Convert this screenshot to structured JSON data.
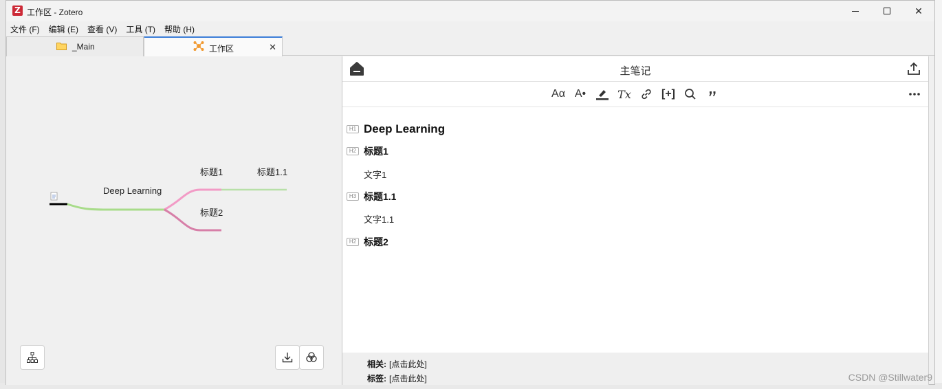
{
  "window": {
    "title": "工作区 - Zotero",
    "logo_letter": "Z",
    "controls": {
      "minimize": "minimize-icon",
      "maximize": "maximize-icon",
      "close": "✕"
    }
  },
  "menubar": {
    "items": [
      "文件 (F)",
      "编辑 (E)",
      "查看 (V)",
      "工具 (T)",
      "帮助 (H)"
    ]
  },
  "tabs": [
    {
      "label": "_Main",
      "icon": "folder-icon",
      "active": false
    },
    {
      "label": "工作区",
      "icon": "mindmap-icon",
      "active": true,
      "close": "✕"
    }
  ],
  "mindmap": {
    "root": "Deep Learning",
    "nodes": [
      "标题1",
      "标题1.1",
      "标题2"
    ],
    "buttons": [
      "outline-icon",
      "download-icon",
      "theme-icon"
    ],
    "colors": {
      "branch1": "#f29bc6",
      "branch1_1": "#b8e0a8",
      "branch2": "#d77fa8",
      "root_line": "#a8dc8a"
    }
  },
  "note": {
    "title": "主笔记",
    "toolbar": [
      "Aα",
      "A•",
      "highlight-icon",
      "Tx",
      "link-icon",
      "[+]",
      "search-icon",
      "quote-icon",
      "more-icon"
    ],
    "content": [
      {
        "badge": "H1",
        "text": "Deep Learning",
        "type": "h1"
      },
      {
        "badge": "H2",
        "text": "标题1",
        "type": "h2"
      },
      {
        "text": "文字1",
        "type": "p"
      },
      {
        "badge": "H3",
        "text": "标题1.1",
        "type": "h3"
      },
      {
        "text": "文字1.1",
        "type": "p"
      },
      {
        "badge": "H2",
        "text": "标题2",
        "type": "h2"
      }
    ],
    "footer": {
      "related_label": "相关:",
      "related_value": "[点击此处]",
      "tags_label": "标签:",
      "tags_value": "[点击此处]"
    }
  },
  "watermark": "CSDN @Stillwater9"
}
